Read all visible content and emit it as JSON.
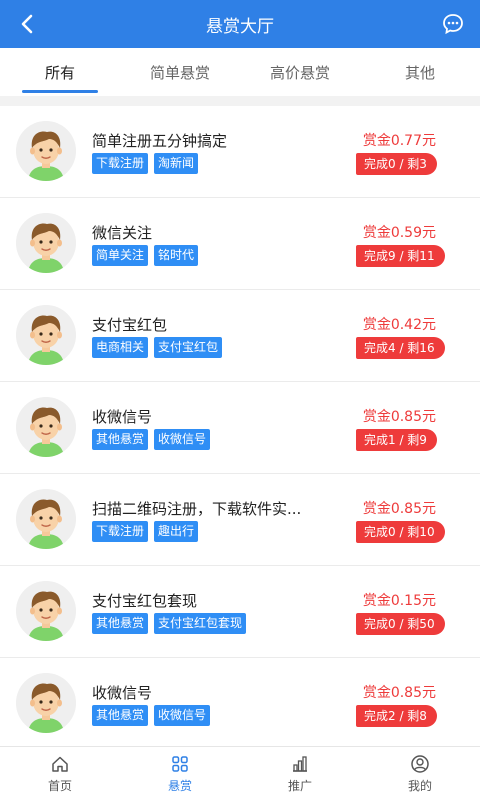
{
  "header": {
    "title": "悬赏大厅",
    "back_icon": "chevron-left-icon",
    "chat_icon": "chat-bubble-icon"
  },
  "tabs": [
    {
      "label": "所有",
      "active": true
    },
    {
      "label": "简单悬赏",
      "active": false
    },
    {
      "label": "高价悬赏",
      "active": false
    },
    {
      "label": "其他",
      "active": false
    }
  ],
  "colors": {
    "primary": "#2f80e6",
    "tag": "#2f8ef5",
    "reward": "#ee3b3b"
  },
  "tasks": [
    {
      "name": "简单注册五分钟搞定",
      "tags": [
        "下载注册",
        "淘新闻"
      ],
      "reward": "赏金0.77元",
      "status": "完成0 / 剩3"
    },
    {
      "name": "微信关注",
      "tags": [
        "简单关注",
        "铭时代"
      ],
      "reward": "赏金0.59元",
      "status": "完成9 / 剩11"
    },
    {
      "name": "支付宝红包",
      "tags": [
        "电商相关",
        "支付宝红包"
      ],
      "reward": "赏金0.42元",
      "status": "完成4 / 剩16"
    },
    {
      "name": "收微信号",
      "tags": [
        "其他悬赏",
        "收微信号"
      ],
      "reward": "赏金0.85元",
      "status": "完成1 / 剩9"
    },
    {
      "name": "扫描二维码注册，下载软件实...",
      "tags": [
        "下载注册",
        "趣出行"
      ],
      "reward": "赏金0.85元",
      "status": "完成0 / 剩10"
    },
    {
      "name": "支付宝红包套现",
      "tags": [
        "其他悬赏",
        "支付宝红包套现"
      ],
      "reward": "赏金0.15元",
      "status": "完成0 / 剩50"
    },
    {
      "name": "收微信号",
      "tags": [
        "其他悬赏",
        "收微信号"
      ],
      "reward": "赏金0.85元",
      "status": "完成2 / 剩8"
    }
  ],
  "bottom_nav": [
    {
      "label": "首页",
      "icon": "home-icon",
      "active": false
    },
    {
      "label": "悬赏",
      "icon": "grid-icon",
      "active": true
    },
    {
      "label": "推广",
      "icon": "chart-icon",
      "active": false
    },
    {
      "label": "我的",
      "icon": "user-icon",
      "active": false
    }
  ]
}
